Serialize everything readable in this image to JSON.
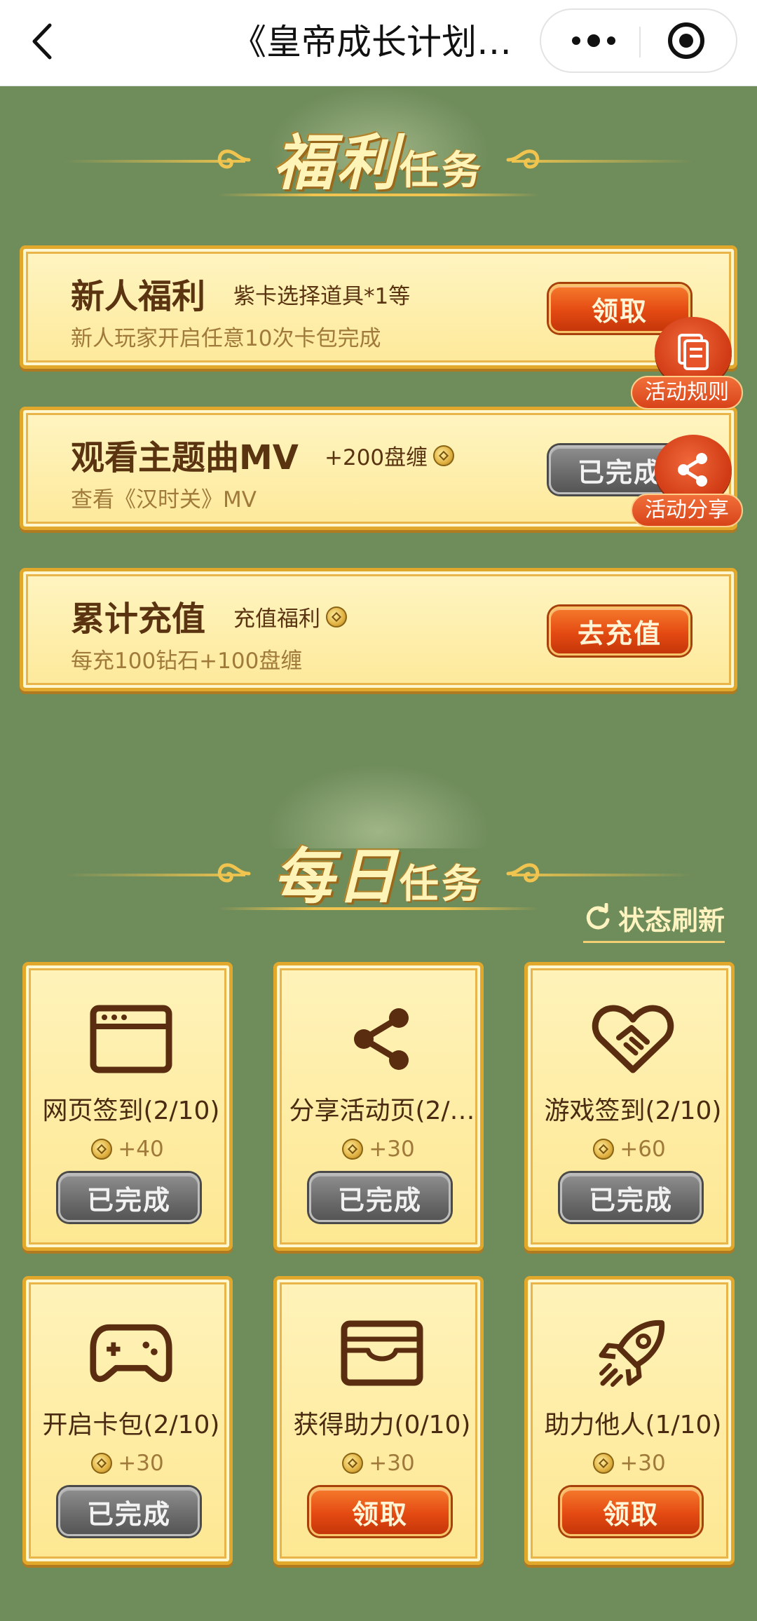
{
  "topbar": {
    "title": "《皇帝成长计划…",
    "back_icon": "chevron-left-icon",
    "more_icon": "more-dots-icon",
    "close_icon": "target-icon"
  },
  "welfare": {
    "heading_big": "福利",
    "heading_small": "任务",
    "cards": [
      {
        "title": "新人福利",
        "reward": "紫卡选择道具*1等",
        "has_coin": false,
        "desc": "新人玩家开启任意10次卡包完成",
        "button": "领取",
        "button_state": "active"
      },
      {
        "title": "观看主题曲MV",
        "reward": "+200盘缠",
        "has_coin": true,
        "desc": "查看《汉时关》MV",
        "button": "已完成",
        "button_state": "done"
      },
      {
        "title": "累计充值",
        "reward": "充值福利",
        "has_coin": true,
        "desc": "每充100钻石+100盘缠",
        "button": "去充值",
        "button_state": "active"
      }
    ]
  },
  "floating": {
    "rules_label": "活动规则",
    "share_label": "活动分享"
  },
  "daily": {
    "heading_big": "每日",
    "heading_small": "任务",
    "refresh_label": "状态刷新",
    "tasks": [
      {
        "name": "网页签到(2/10)",
        "icon": "browser-window-icon",
        "reward": "+40",
        "button": "已完成",
        "button_state": "done"
      },
      {
        "name": "分享活动页(2/…",
        "icon": "share-icon",
        "reward": "+30",
        "button": "已完成",
        "button_state": "done"
      },
      {
        "name": "游戏签到(2/10)",
        "icon": "heart-handshake-icon",
        "reward": "+60",
        "button": "已完成",
        "button_state": "done"
      },
      {
        "name": "开启卡包(2/10)",
        "icon": "gamepad-icon",
        "reward": "+30",
        "button": "已完成",
        "button_state": "done"
      },
      {
        "name": "获得助力(0/10)",
        "icon": "wallet-icon",
        "reward": "+30",
        "button": "领取",
        "button_state": "active"
      },
      {
        "name": "助力他人(1/10)",
        "icon": "rocket-icon",
        "reward": "+30",
        "button": "领取",
        "button_state": "active"
      }
    ]
  },
  "colors": {
    "background": "#6f8c5b",
    "card_fill": "#fde99a",
    "card_border": "#e2a82c",
    "active_button": "#e44a12",
    "done_button": "#6a6a6a",
    "text_brown": "#5a3311"
  }
}
